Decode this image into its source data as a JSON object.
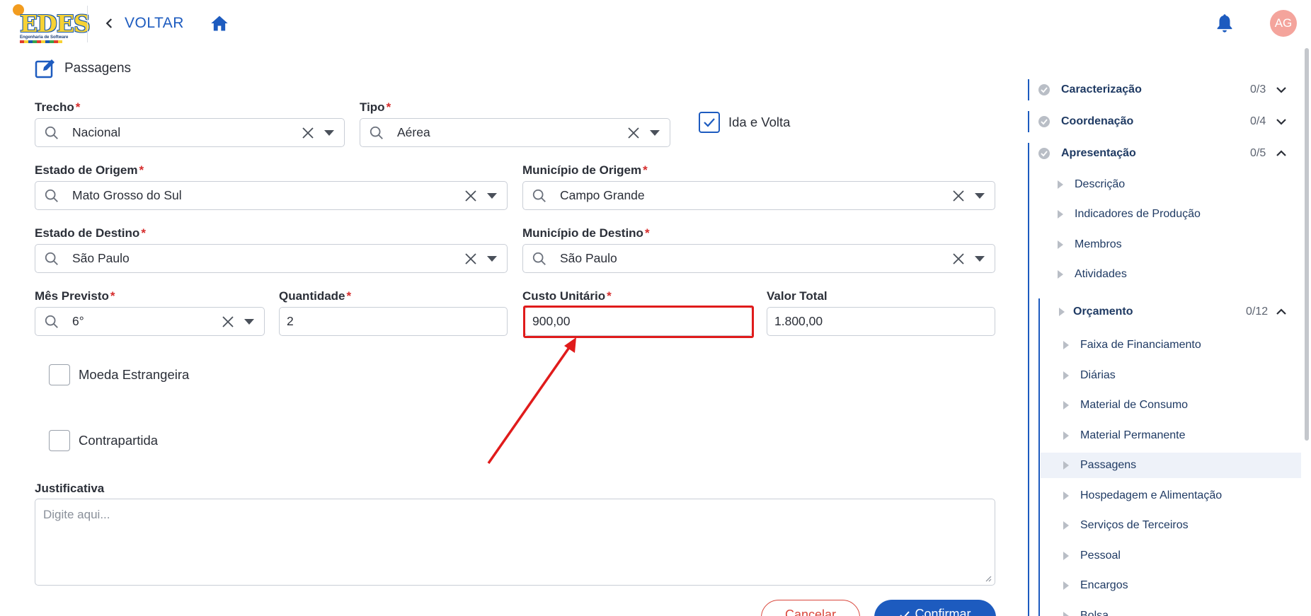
{
  "header": {
    "logo_text": "EDES",
    "logo_subtitle": "Engenharia de Software",
    "back_label": "VOLTAR",
    "avatar_initials": "AG",
    "accent_color": "#1d5bbf"
  },
  "form": {
    "section_title": "Passagens",
    "trecho": {
      "label": "Trecho",
      "value": "Nacional"
    },
    "tipo": {
      "label": "Tipo",
      "value": "Aérea"
    },
    "ida_volta": {
      "label": "Ida e Volta",
      "checked": true
    },
    "estado_origem": {
      "label": "Estado de Origem",
      "value": "Mato Grosso do Sul"
    },
    "municipio_origem": {
      "label": "Município de Origem",
      "value": "Campo Grande"
    },
    "estado_destino": {
      "label": "Estado de Destino",
      "value": "São Paulo"
    },
    "municipio_destino": {
      "label": "Município de Destino",
      "value": "São Paulo"
    },
    "mes_previsto": {
      "label": "Mês Previsto",
      "value": "6°"
    },
    "quantidade": {
      "label": "Quantidade",
      "value": "2"
    },
    "custo_unitario": {
      "label": "Custo Unitário",
      "value": "900,00"
    },
    "valor_total": {
      "label": "Valor Total",
      "value": "1.800,00"
    },
    "moeda_estrangeira": {
      "label": "Moeda Estrangeira",
      "checked": false
    },
    "contrapartida": {
      "label": "Contrapartida",
      "checked": false
    },
    "justificativa": {
      "label": "Justificativa",
      "placeholder": "Digite aqui..."
    },
    "cancel_label": "Cancelar",
    "confirm_label": "Confirmar",
    "required_mark": "*"
  },
  "sidebar": {
    "groups": [
      {
        "label": "Caracterização",
        "count": "0/3",
        "expanded": false
      },
      {
        "label": "Coordenação",
        "count": "0/4",
        "expanded": false
      },
      {
        "label": "Apresentação",
        "count": "0/5",
        "expanded": true
      }
    ],
    "apresentacao_items": [
      "Descrição",
      "Indicadores de Produção",
      "Membros",
      "Atividades"
    ],
    "orcamento": {
      "label": "Orçamento",
      "count": "0/12",
      "expanded": true
    },
    "orcamento_items": [
      "Faixa de Financiamento",
      "Diárias",
      "Material de Consumo",
      "Material Permanente",
      "Passagens",
      "Hospedagem e Alimentação",
      "Serviços de Terceiros",
      "Pessoal",
      "Encargos",
      "Bolsa"
    ],
    "active_item": "Passagens"
  }
}
